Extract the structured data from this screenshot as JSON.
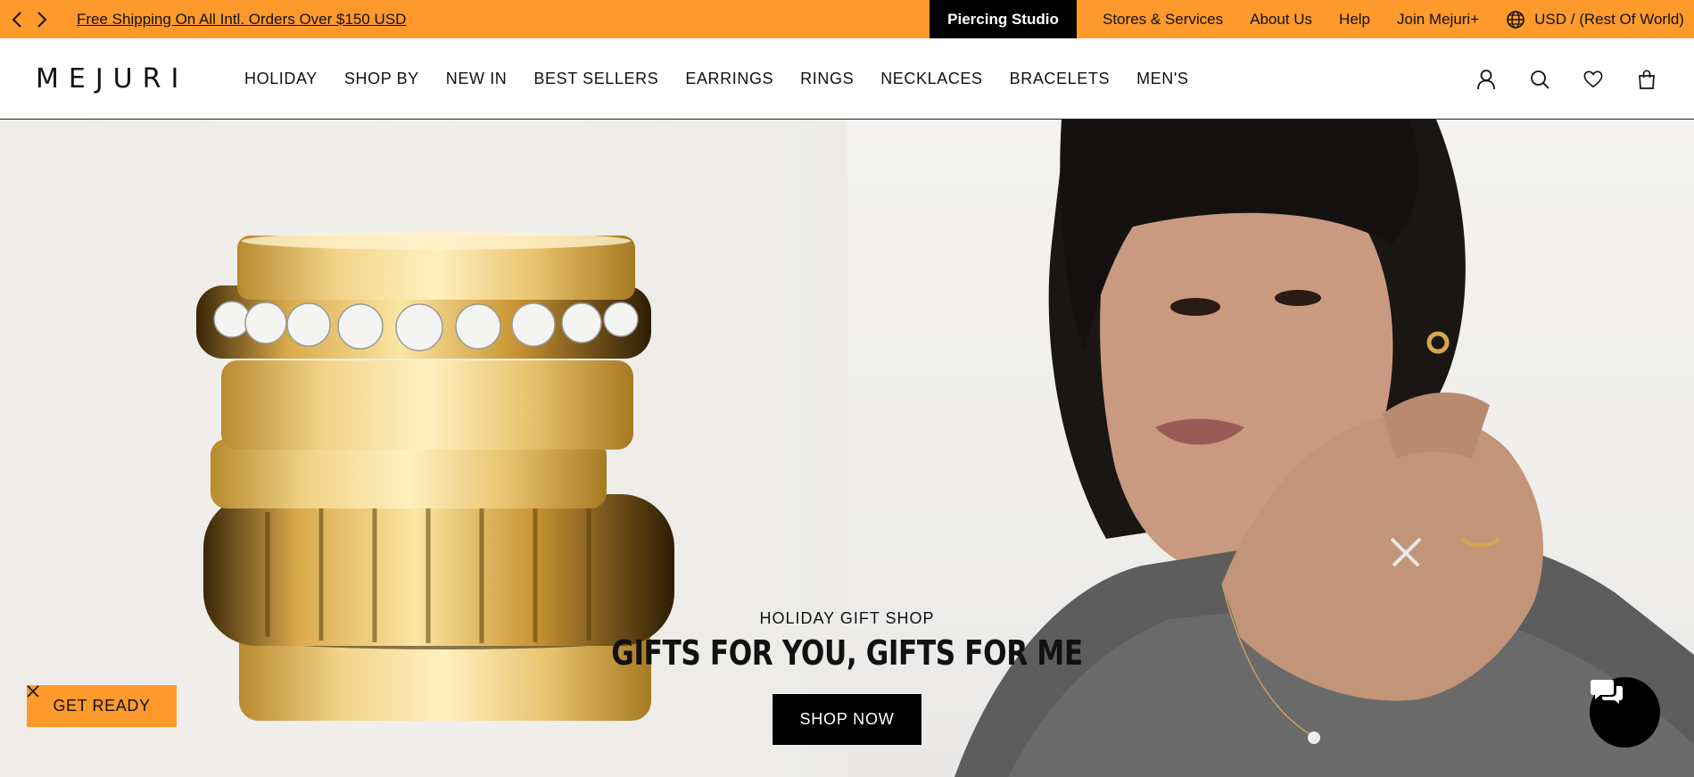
{
  "promo": {
    "prev_label": "‹",
    "next_label": "›",
    "message": "Free Shipping On All Intl. Orders Over $150 USD",
    "piercing": "Piercing Studio",
    "links": [
      "Stores & Services",
      "About Us",
      "Help",
      "Join Mejuri+"
    ],
    "currency": "USD / (Rest Of World)"
  },
  "nav": {
    "logo": "MEJURI",
    "menu": [
      "HOLIDAY",
      "SHOP BY",
      "NEW IN",
      "BEST SELLERS",
      "EARRINGS",
      "RINGS",
      "NECKLACES",
      "BRACELETS",
      "MEN'S"
    ],
    "icons": [
      "account-icon",
      "search-icon",
      "wishlist-icon",
      "bag-icon"
    ]
  },
  "hero": {
    "eyebrow": "HOLIDAY GIFT SHOP",
    "headline": "GIFTS FOR YOU, GIFTS FOR ME",
    "cta": "SHOP NOW"
  },
  "floating": {
    "get_ready": "GET READY"
  },
  "colors": {
    "accent": "#fd9a2b",
    "black": "#000000"
  }
}
